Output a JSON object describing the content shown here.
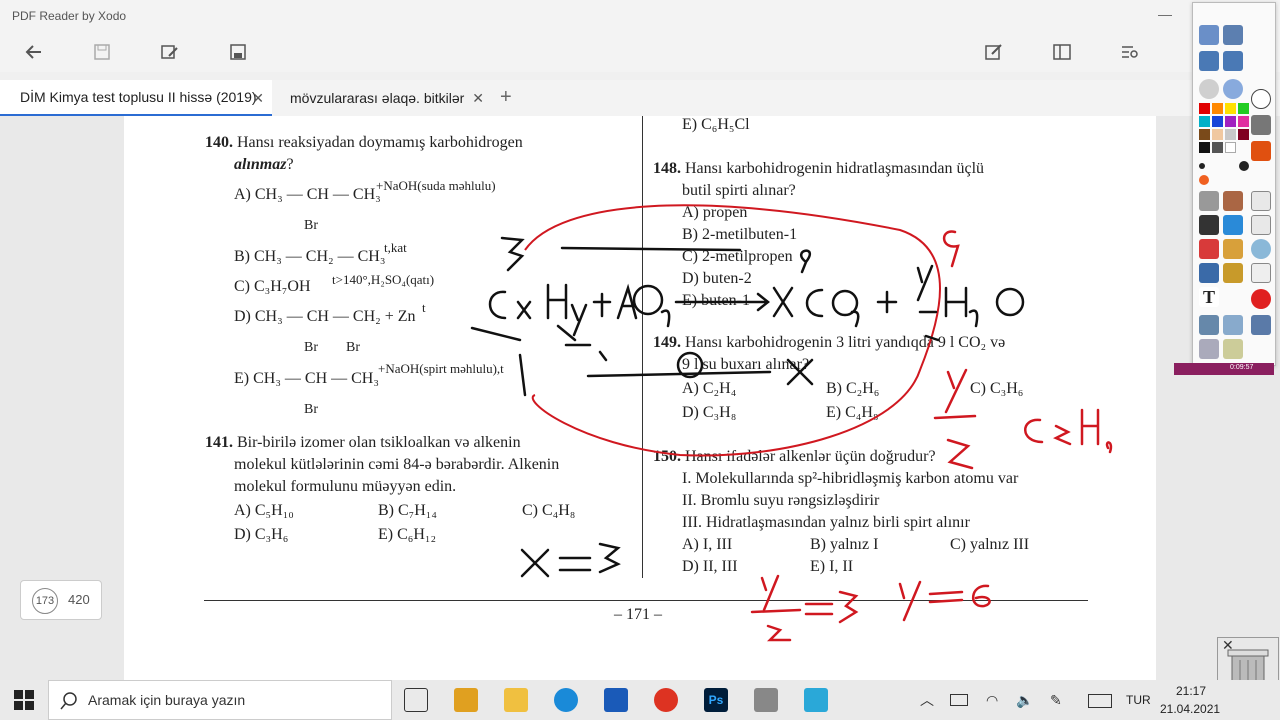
{
  "app": {
    "title": "PDF Reader by Xodo"
  },
  "tabs": [
    {
      "label": "DİM Kimya test toplusu II hissə (2019)"
    },
    {
      "label": "mövzulararası əlaqə. bitkilər"
    }
  ],
  "doc": {
    "q140": {
      "num": "140.",
      "text": "Hansı reaksiyadan doymamış karbohidrogen",
      "emph": "alınmaz",
      "qmark": "?"
    },
    "q140_opts": {
      "a": "A) CH₃ — CH — CH₃",
      "a_cond": "+NaOH(suda məhlulu)",
      "a_br": "Br",
      "b": "B) CH₃ — CH₂ — CH₃",
      "b_cond": "t,kat",
      "c": "C) C₃H₇OH",
      "c_cond": "t>140°,H₂SO₄(qatı)",
      "d": "D) CH₃ — CH — CH₂ + Zn",
      "d_cond": "t",
      "d_br1": "Br",
      "d_br2": "Br",
      "e": "E) CH₃ — CH — CH₃",
      "e_cond": "+NaOH(spirt məhlulu),t",
      "e_br": "Br"
    },
    "q141": {
      "num": "141.",
      "l1": "Bir-birilə izomer olan tsikloalkan və alkenin",
      "l2": "molekul kütlələrinin cəmi 84-ə bərabərdir. Alkenin",
      "l3": "molekul formulunu müəyyən edin."
    },
    "q141_opts": {
      "a": "A) C₅H₁₀",
      "b": "B) C₇H₁₄",
      "c": "C) C₄H₈",
      "d": "D) C₃H₆",
      "e": "E) C₆H₁₂"
    },
    "e_prev": "E) C₆H₅Cl",
    "q148": {
      "num": "148.",
      "l1": "Hansı karbohidrogenin hidratlaşmasından üçlü",
      "l2": "butil spirti alınar?"
    },
    "q148_opts": {
      "a": "A) propen",
      "b": "B) 2-metilbuten-1",
      "c": "C) 2-metilpropen",
      "d": "D) buten-2",
      "e": "E) buten-1"
    },
    "q149": {
      "num": "149.",
      "l1": "Hansı karbohidrogenin 3 litri yandıqda 9 l CO₂ və",
      "l2": "9 l su buxarı alınar?"
    },
    "q149_opts": {
      "a": "A) C₂H₄",
      "b": "B) C₂H₆",
      "c": "C) C₃H₆",
      "d": "D) C₃H₈",
      "e": "E) C₄H₈"
    },
    "q150": {
      "num": "150.",
      "l1": "Hansı ifadələr alkenlər üçün doğrudur?",
      "i1": "I. Molekullarında sp²-hibridləşmiş karbon atomu var",
      "i2": "II. Bromlu suyu rəngsizləşdirir",
      "i3": "III. Hidratlaşmasından yalnız birli spirt alınır"
    },
    "q150_opts": {
      "a": "A) I, III",
      "b": "B) yalnız I",
      "c": "C) yalnız III",
      "d": "D) II, III",
      "e": "E) I, II"
    },
    "page_footer": "– 171 –"
  },
  "page_indicator": {
    "current": "173",
    "total": "420"
  },
  "rec_time": "0:09:57",
  "taskbar": {
    "search_placeholder": "Aramak için buraya yazın",
    "lang": "TUR",
    "time": "21:17",
    "date": "21.04.2021"
  },
  "colors": {
    "ink_black": "#111111",
    "ink_red": "#d01820",
    "tab_accent": "#2b6cd3"
  }
}
